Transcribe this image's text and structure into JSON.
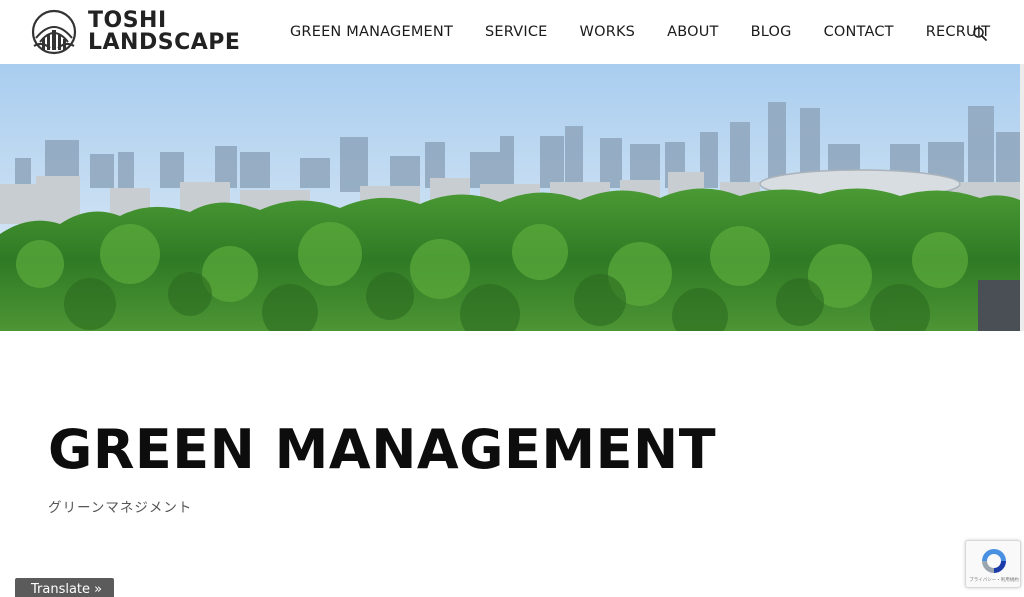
{
  "brand": {
    "line1": "TOSHI",
    "line2": "LANDSCAPE"
  },
  "nav": {
    "items": [
      "GREEN MANAGEMENT",
      "SERVICE",
      "WORKS",
      "ABOUT",
      "BLOG",
      "CONTACT",
      "RECRUIT"
    ],
    "search_icon": "search-icon"
  },
  "hero": {
    "image": "city-skyline-over-forest"
  },
  "page": {
    "title": "GREEN MANAGEMENT",
    "subtitle": "グリーンマネジメント"
  },
  "translate": {
    "label": "Translate »"
  },
  "recaptcha": {
    "text": "プライバシー・利用規約"
  },
  "colors": {
    "sky": "#cfe3f5",
    "forest": "#3f8a2a",
    "translate_bg": "#5b5b5b"
  }
}
